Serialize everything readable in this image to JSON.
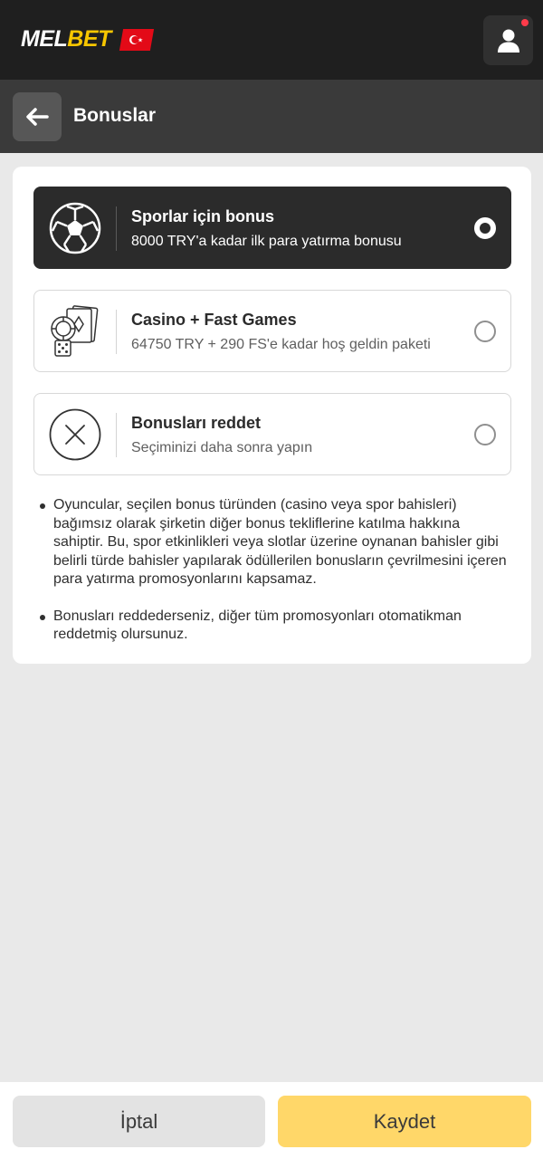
{
  "header": {
    "logo_part1": "MEL",
    "logo_part2": "BET",
    "flag_icon": "turkey-flag-icon",
    "user_icon": "user-icon",
    "notification_dot_color": "#ff3b4a"
  },
  "subheader": {
    "back_icon": "arrow-left-icon",
    "title": "Bonuslar"
  },
  "options": [
    {
      "icon": "soccer-ball-icon",
      "title": "Sporlar için bonus",
      "subtitle": "8000 TRY'a kadar ilk para yatırma bonusu",
      "selected": true
    },
    {
      "icon": "casino-cards-dice-icon",
      "title": "Casino + Fast Games",
      "subtitle": "64750 TRY + 290 FS'e kadar hoş geldin paketi",
      "selected": false
    },
    {
      "icon": "close-circle-icon",
      "title": "Bonusları reddet",
      "subtitle": "Seçiminizi daha sonra yapın",
      "selected": false
    }
  ],
  "notes": [
    "Oyuncular, seçilen bonus türünden (casino veya spor bahisleri) bağımsız olarak şirketin diğer bonus tekliflerine katılma hakkına sahiptir. Bu, spor etkinlikleri veya slotlar üzerine oynanan bahisler gibi belirli türde bahisler yapılarak ödüllerilen bonusların çevrilmesini içeren para yatırma promosyonlarını kapsamaz.",
    "Bonusları reddederseniz, diğer tüm promosyonları otomatikman reddetmiş olursunuz."
  ],
  "footer": {
    "cancel_label": "İptal",
    "save_label": "Kaydet"
  },
  "colors": {
    "header_bg": "#1f1f1f",
    "accent_yellow": "#f7c600",
    "save_button": "#ffd769",
    "selected_option_bg": "#2b2b2b"
  }
}
